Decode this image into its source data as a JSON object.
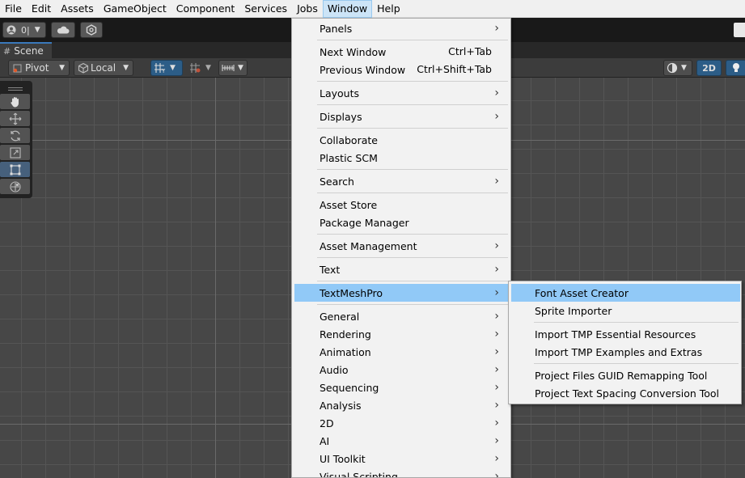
{
  "menubar": {
    "items": [
      "File",
      "Edit",
      "Assets",
      "GameObject",
      "Component",
      "Services",
      "Jobs",
      "Window",
      "Help"
    ],
    "active": "Window"
  },
  "toolbar": {
    "account_label": "0|",
    "account_icon": "account-icon",
    "cloud_icon": "cloud-icon",
    "collab_icon": "collab-icon"
  },
  "scene_tab": {
    "label": "Scene",
    "icon": "hash-icon"
  },
  "scene_toolbar": {
    "pivot_label": "Pivot",
    "local_label": "Local",
    "mode_2d": "2D"
  },
  "window_menu": {
    "items": [
      {
        "label": "Panels",
        "submenu": true,
        "shortcut": ""
      },
      {
        "label": "Next Window",
        "submenu": false,
        "shortcut": "Ctrl+Tab"
      },
      {
        "label": "Previous Window",
        "submenu": false,
        "shortcut": "Ctrl+Shift+Tab"
      },
      {
        "label": "Layouts",
        "submenu": true,
        "shortcut": ""
      },
      {
        "label": "Displays",
        "submenu": true,
        "shortcut": ""
      },
      {
        "label": "Collaborate",
        "submenu": false,
        "shortcut": ""
      },
      {
        "label": "Plastic SCM",
        "submenu": false,
        "shortcut": ""
      },
      {
        "label": "Search",
        "submenu": true,
        "shortcut": ""
      },
      {
        "label": "Asset Store",
        "submenu": false,
        "shortcut": ""
      },
      {
        "label": "Package Manager",
        "submenu": false,
        "shortcut": ""
      },
      {
        "label": "Asset Management",
        "submenu": true,
        "shortcut": ""
      },
      {
        "label": "Text",
        "submenu": true,
        "shortcut": ""
      },
      {
        "label": "TextMeshPro",
        "submenu": true,
        "shortcut": "",
        "highlighted": true
      },
      {
        "label": "General",
        "submenu": true,
        "shortcut": ""
      },
      {
        "label": "Rendering",
        "submenu": true,
        "shortcut": ""
      },
      {
        "label": "Animation",
        "submenu": true,
        "shortcut": ""
      },
      {
        "label": "Audio",
        "submenu": true,
        "shortcut": ""
      },
      {
        "label": "Sequencing",
        "submenu": true,
        "shortcut": ""
      },
      {
        "label": "Analysis",
        "submenu": true,
        "shortcut": ""
      },
      {
        "label": "2D",
        "submenu": true,
        "shortcut": ""
      },
      {
        "label": "AI",
        "submenu": true,
        "shortcut": ""
      },
      {
        "label": "UI Toolkit",
        "submenu": true,
        "shortcut": ""
      },
      {
        "label": "Visual Scripting",
        "submenu": true,
        "shortcut": ""
      }
    ]
  },
  "textmeshpro_submenu": {
    "items": [
      {
        "label": "Font Asset Creator",
        "highlighted": true
      },
      {
        "label": "Sprite Importer"
      },
      {
        "label": "Import TMP Essential Resources"
      },
      {
        "label": "Import TMP Examples and Extras"
      },
      {
        "label": "Project Files GUID Remapping Tool"
      },
      {
        "label": "Project Text Spacing Conversion Tool"
      }
    ]
  },
  "colors": {
    "highlight": "#91c9f7",
    "menu_bg": "#f2f2f2",
    "scene_bg": "#474747",
    "toolbar_bg": "#191919"
  }
}
